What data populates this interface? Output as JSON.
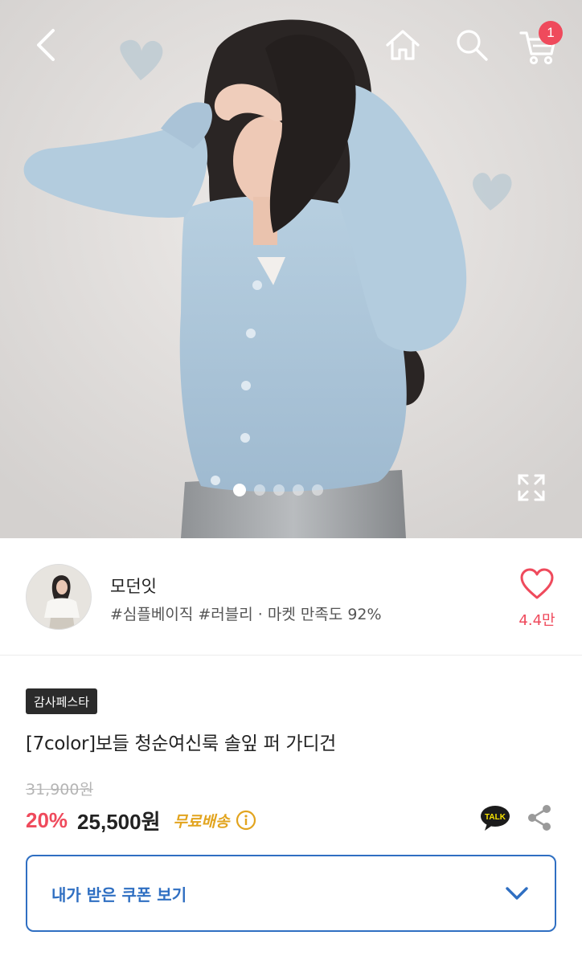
{
  "hero": {
    "image_description_icon": "product-photo",
    "slides_total": 5,
    "slide_active": 1
  },
  "topbar": {
    "cart_count": "1"
  },
  "seller": {
    "name": "모던잇",
    "tags": "#심플베이직 #러블리 · 마켓 만족도 92%",
    "likes": "4.4만"
  },
  "product": {
    "badge": "감사페스타",
    "title": "[7color]보들 청순여신룩 솔잎 퍼 가디건",
    "original_price": "31,900원",
    "discount": "20%",
    "price": "25,500원",
    "shipping": "무료배송"
  },
  "coupon": {
    "label": "내가 받은 쿠폰 보기"
  },
  "colors": {
    "accent_red": "#ef4a5c",
    "accent_blue": "#2f6fc2",
    "shipping_yellow": "#e2a41e",
    "sweater_blue": "#a9c4d8"
  }
}
